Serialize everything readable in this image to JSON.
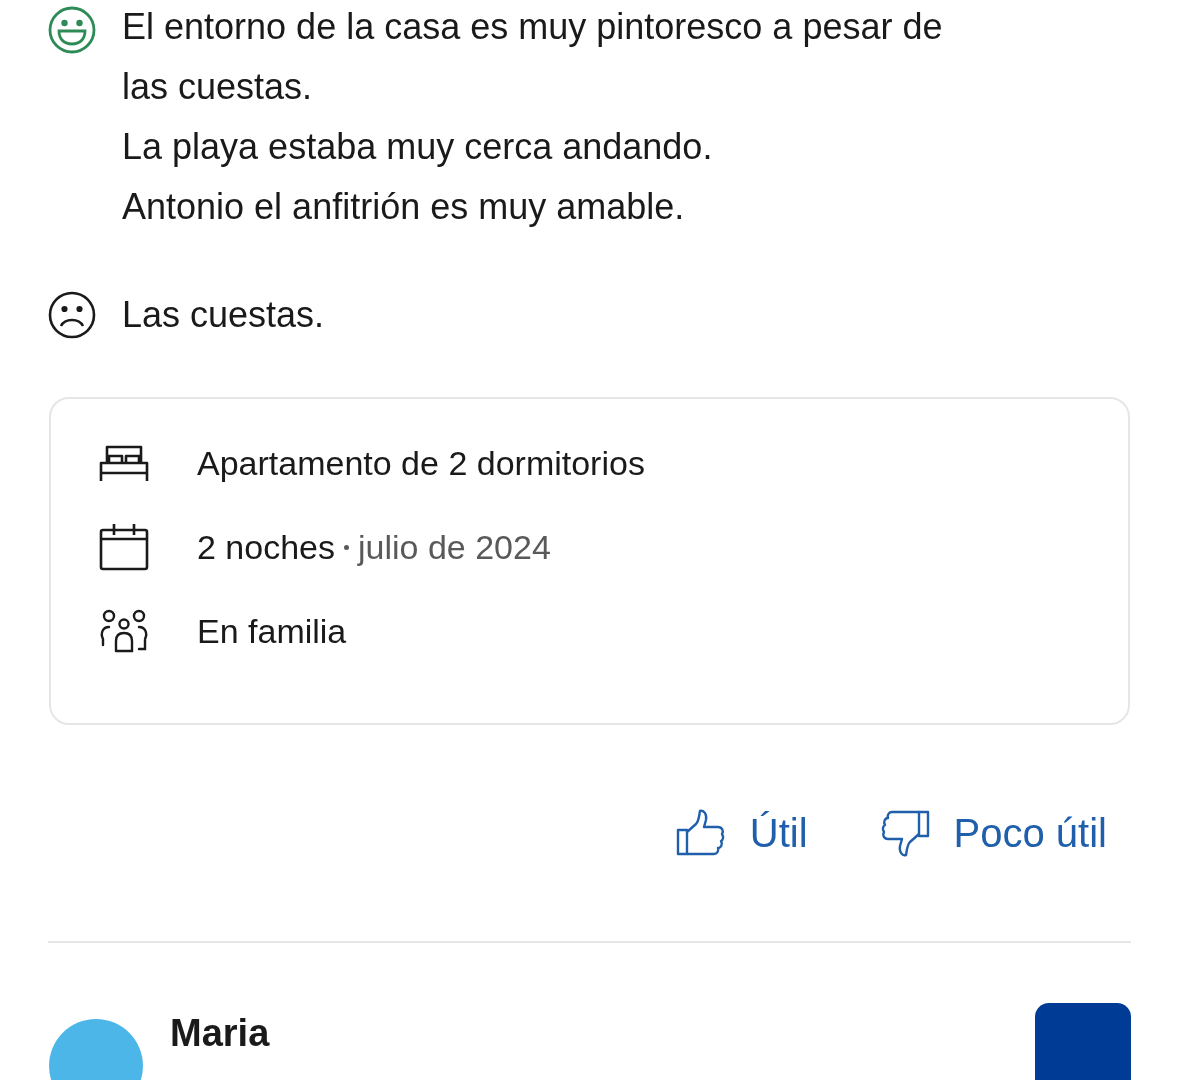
{
  "review": {
    "positive": {
      "text": "El entorno de la casa es muy pintoresco a pesar de las cuestas.\nLa playa estaba muy cerca andando.\nAntonio el anfitrión es muy amable."
    },
    "negative": {
      "text": "Las cuestas."
    },
    "stay_details": [
      {
        "kind": "room",
        "text": "Apartamento de 2 dormitorios"
      },
      {
        "kind": "dates",
        "text": "2 noches",
        "detail": "julio de 2024"
      },
      {
        "kind": "group",
        "text": "En familia"
      }
    ],
    "actions": [
      {
        "kind": "helpful",
        "label": "Útil"
      },
      {
        "kind": "not_helpful",
        "label": "Poco útil"
      }
    ]
  },
  "next_review": {
    "name": "Maria"
  }
}
